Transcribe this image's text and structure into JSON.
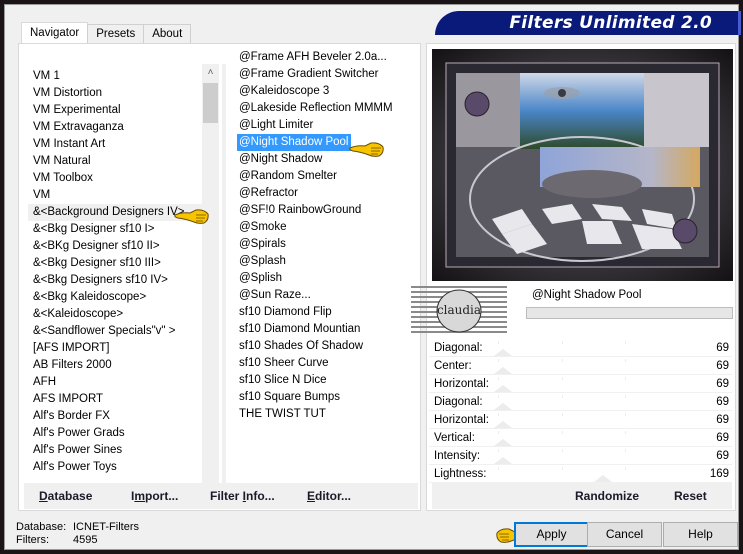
{
  "window": {
    "title": "Filters Unlimited 2.0"
  },
  "tabs": [
    {
      "label": "Navigator",
      "active": true
    },
    {
      "label": "Presets",
      "active": false
    },
    {
      "label": "About",
      "active": false
    }
  ],
  "categories": {
    "selected_index": 8,
    "items": [
      "VM 1",
      "VM Distortion",
      "VM Experimental",
      "VM Extravaganza",
      "VM Instant Art",
      "VM Natural",
      "VM Toolbox",
      "VM",
      "&<Background Designers IV>",
      "&<Bkg Designer sf10 I>",
      "&<BKg Designer sf10 II>",
      "&<Bkg Designer sf10 III>",
      "&<Bkg Designers sf10 IV>",
      "&<Bkg Kaleidoscope>",
      "&<Kaleidoscope>",
      "&<Sandflower Specials\"v\" >",
      "[AFS IMPORT]",
      "AB Filters 2000",
      "AFH",
      "AFS IMPORT",
      "Alf's Border FX",
      "Alf's Power Grads",
      "Alf's Power Sines",
      "Alf's Power Toys"
    ]
  },
  "filters": {
    "selected_index": 5,
    "items": [
      "@Frame AFH Beveler 2.0a...",
      "@Frame Gradient Switcher",
      "@Kaleidoscope 3",
      "@Lakeside Reflection MMMM",
      "@Light Limiter",
      "@Night Shadow Pool",
      "@Night Shadow",
      "@Random Smelter",
      "@Refractor",
      "@SF!0 RainbowGround",
      "@Smoke",
      "@Spirals",
      "@Splash",
      "@Splish",
      "@Sun Raze...",
      "sf10 Diamond Flip",
      "sf10 Diamond Mountian",
      "sf10 Shades Of Shadow",
      "sf10 Sheer Curve",
      "sf10 Slice N Dice",
      "sf10 Square Bumps",
      "THE TWIST TUT"
    ]
  },
  "left_buttons": {
    "database": {
      "pre": "",
      "u": "D",
      "post": "atabase"
    },
    "import": {
      "pre": "I",
      "u": "m",
      "post": "port..."
    },
    "filter_info": {
      "pre": "Filter ",
      "u": "I",
      "post": "nfo..."
    },
    "editor": {
      "pre": "",
      "u": "E",
      "post": "ditor..."
    }
  },
  "preview": {
    "filter_name": "@Night Shadow Pool",
    "progress": 0,
    "watermark": "claudia"
  },
  "parameters": [
    {
      "label": "Diagonal:",
      "value": 69
    },
    {
      "label": "Center:",
      "value": 69
    },
    {
      "label": "Horizontal:",
      "value": 69
    },
    {
      "label": "Diagonal:",
      "value": 69
    },
    {
      "label": "Horizontal:",
      "value": 69
    },
    {
      "label": "Vertical:",
      "value": 69
    },
    {
      "label": "Intensity:",
      "value": 69
    },
    {
      "label": "Lightness:",
      "value": 169
    }
  ],
  "param_max": 255,
  "right_buttons": {
    "randomize": "Randomize",
    "reset": "Reset"
  },
  "status": {
    "database_label": "Database:",
    "database_value": "ICNET-Filters",
    "filters_label": "Filters:",
    "filters_value": "4595"
  },
  "dialog_buttons": {
    "apply": "Apply",
    "cancel": "Cancel",
    "help": "Help"
  },
  "colors": {
    "banner": "#0a1a7a",
    "selection": "#3399ff",
    "default_button_border": "#0078d7"
  }
}
